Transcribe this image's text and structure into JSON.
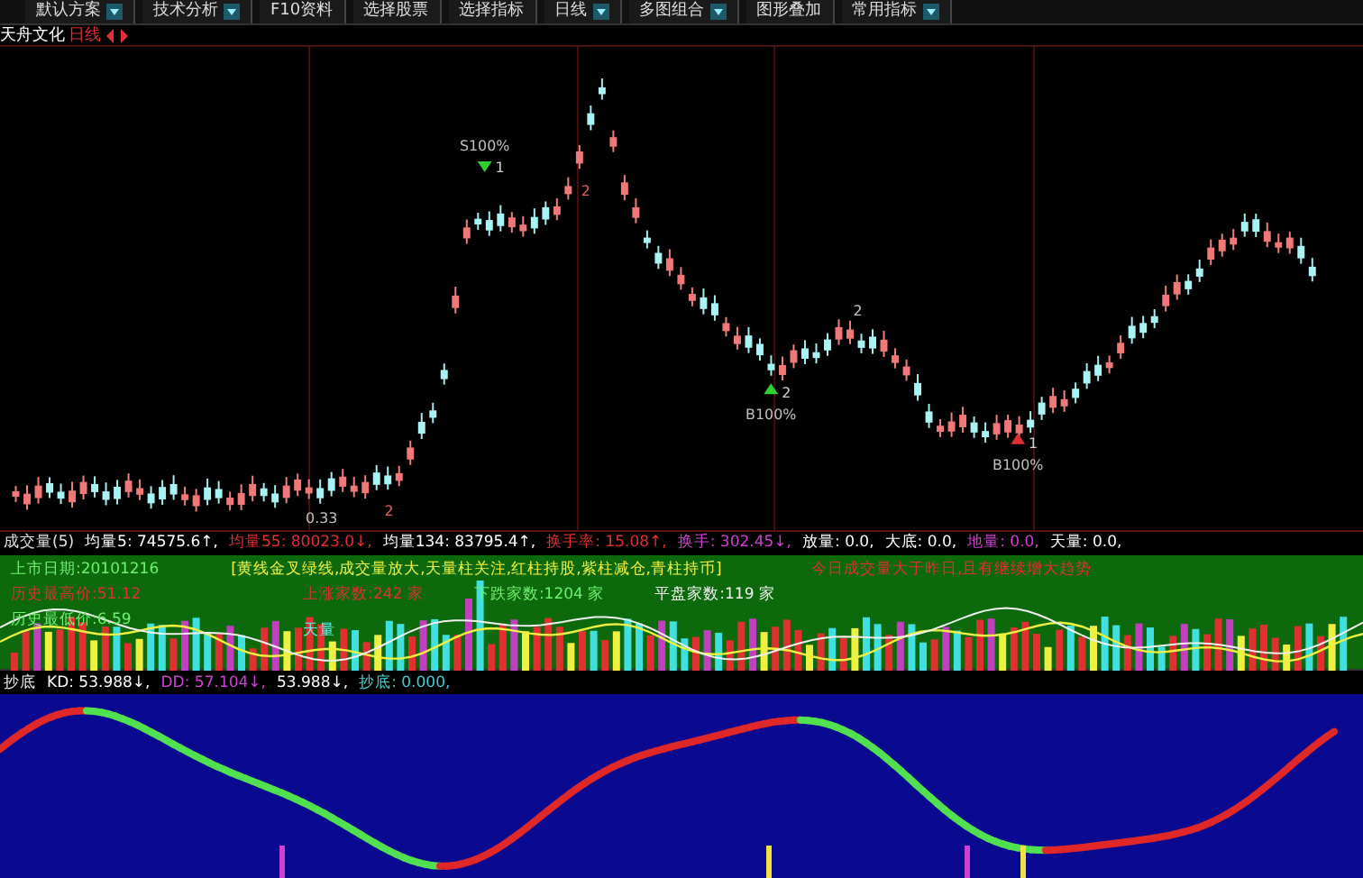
{
  "toolbar": [
    {
      "label": "默认方案",
      "dropdown": true
    },
    {
      "label": "技术分析",
      "dropdown": true
    },
    {
      "label": "F10资料",
      "dropdown": false
    },
    {
      "label": "选择股票",
      "dropdown": false
    },
    {
      "label": "选择指标",
      "dropdown": false
    },
    {
      "label": "日线",
      "dropdown": true
    },
    {
      "label": "多图组合",
      "dropdown": true
    },
    {
      "label": "图形叠加",
      "dropdown": false
    },
    {
      "label": "常用指标",
      "dropdown": true
    }
  ],
  "stock": {
    "name": "天舟文化",
    "period": "日线"
  },
  "signals": [
    {
      "label": "S100%",
      "marker": "1",
      "kind": "sell"
    },
    {
      "label": "B100%",
      "marker": "2",
      "kind": "buy"
    },
    {
      "label": "B100%",
      "marker": "1",
      "kind": "buy"
    }
  ],
  "markers": [
    {
      "text": "2",
      "kind": "sell"
    },
    {
      "text": "2",
      "kind": "buy"
    },
    {
      "text": "2",
      "kind": "sell"
    },
    {
      "text": "0.33",
      "kind": "buy"
    }
  ],
  "volume_panel": {
    "readings": [
      {
        "text": "成交量(5)",
        "color": "#e0e0e0"
      },
      {
        "text": "均量5: 74575.6↑,",
        "color": "#ffffff"
      },
      {
        "text": "均量55: 80023.0↓,",
        "color": "#e03030"
      },
      {
        "text": "均量134: 83795.4↑,",
        "color": "#ffffff"
      },
      {
        "text": "换手率: 15.08↑,",
        "color": "#e03030"
      },
      {
        "text": "换手: 302.45↓,",
        "color": "#d040d0"
      },
      {
        "text": "放量: 0.0,",
        "color": "#ffffff"
      },
      {
        "text": "大底: 0.0,",
        "color": "#ffffff"
      },
      {
        "text": "地量: 0.0,",
        "color": "#d040d0"
      },
      {
        "text": "天量: 0.0,",
        "color": "#ffffff"
      }
    ],
    "listing_date": "上市日期:20101216",
    "high_price": "历史最高价:51.12",
    "low_price": "历史最低价:6.59",
    "legend": "[黄线金叉绿线,成交量放大,天量柱关注,红柱持股,紫柱减仓,青柱持币]",
    "rising": "上涨家数:242 家",
    "falling": "下跌家数:1204 家",
    "flat": "平盘家数:119 家",
    "notice": "今日成交量大于昨日,且有继续增大趋势",
    "peak_label": "天量"
  },
  "kd_panel": {
    "readings": [
      {
        "text": "抄底",
        "kind": "label"
      },
      {
        "text": "KD: 53.988↓,",
        "kind": "value"
      },
      {
        "text": "DD: 57.104↓,",
        "kind": "dd"
      },
      {
        "text": "53.988↓,",
        "kind": "value"
      },
      {
        "text": "抄底: 0.000,",
        "kind": "signal"
      }
    ]
  }
}
